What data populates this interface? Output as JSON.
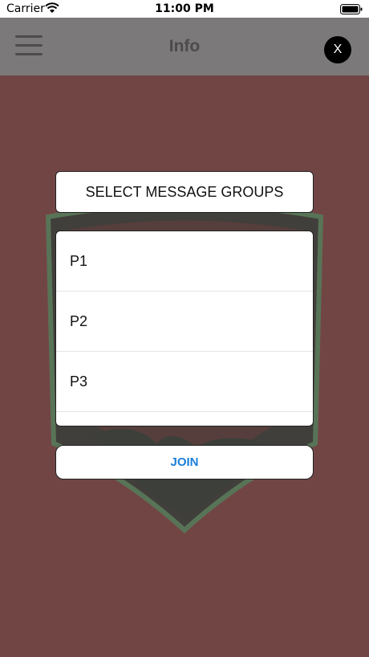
{
  "status_bar": {
    "carrier": "Carrier",
    "time": "11:00 PM"
  },
  "navbar": {
    "title": "Info",
    "close_label": "X"
  },
  "dialog": {
    "header": "SELECT MESSAGE GROUPS",
    "groups": [
      "P1",
      "P2",
      "P3"
    ],
    "join_label": "JOIN"
  },
  "colors": {
    "background": "#724545",
    "navbar": "#7b7979",
    "accent": "#1a7fd8"
  }
}
